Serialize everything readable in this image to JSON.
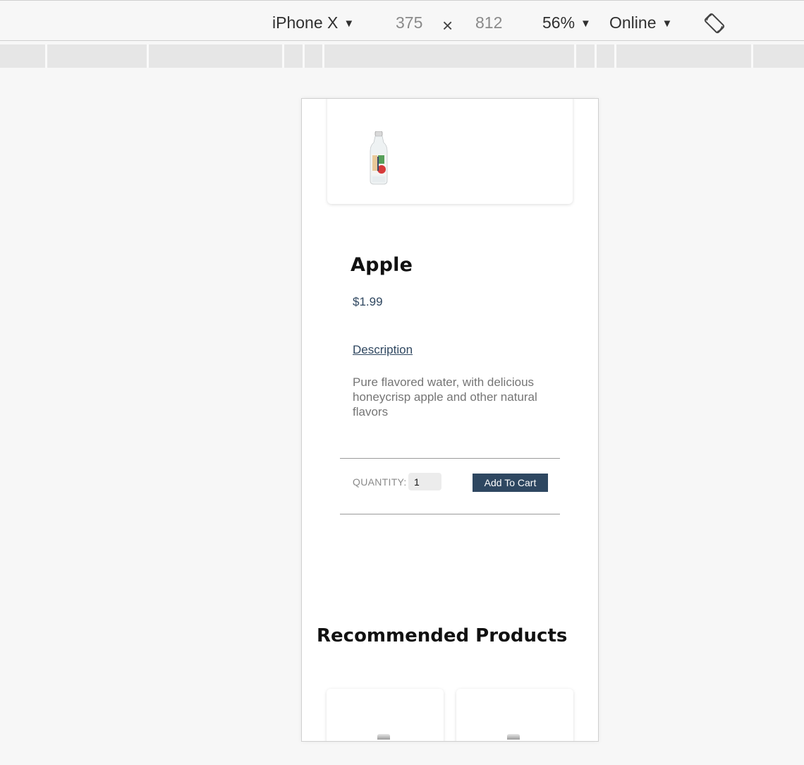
{
  "devtools": {
    "device": "iPhone X",
    "width": "375",
    "height": "812",
    "times": "×",
    "zoom": "56%",
    "network": "Online",
    "caret": "▼"
  },
  "product": {
    "image_icon": "water-bottle-image",
    "title": "Apple",
    "price": "$1.99",
    "description_label": "Description",
    "description": "Pure flavored water, with delicious honeycrisp apple and other natural flavors",
    "quantity_label": "QUANTITY:",
    "quantity_value": "1",
    "add_to_cart": "Add To Cart"
  },
  "recommended": {
    "heading": "Recommended Products"
  },
  "colors": {
    "accent": "#2e4761",
    "price": "#2f4760",
    "muted_text": "#757575"
  }
}
